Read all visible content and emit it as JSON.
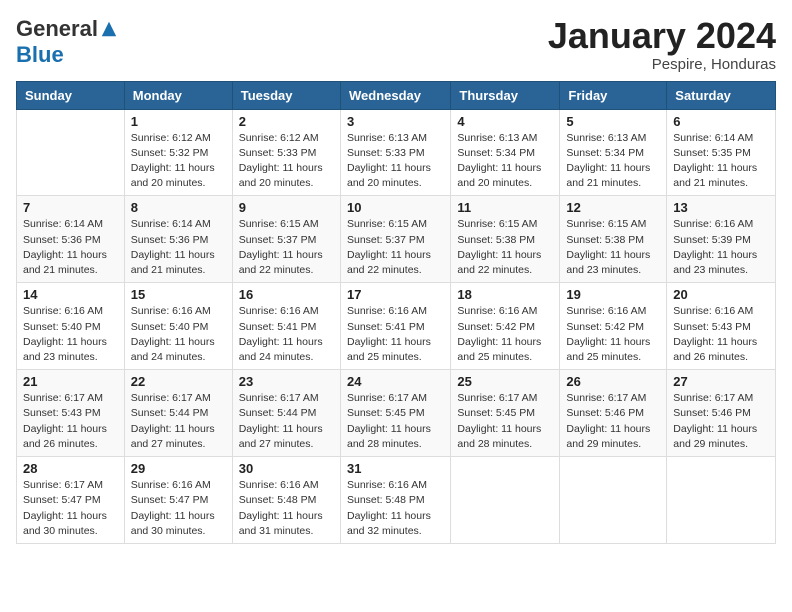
{
  "logo": {
    "general": "General",
    "blue": "Blue"
  },
  "header": {
    "month": "January 2024",
    "location": "Pespire, Honduras"
  },
  "weekdays": [
    "Sunday",
    "Monday",
    "Tuesday",
    "Wednesday",
    "Thursday",
    "Friday",
    "Saturday"
  ],
  "weeks": [
    [
      {
        "day": "",
        "info": ""
      },
      {
        "day": "1",
        "info": "Sunrise: 6:12 AM\nSunset: 5:32 PM\nDaylight: 11 hours\nand 20 minutes."
      },
      {
        "day": "2",
        "info": "Sunrise: 6:12 AM\nSunset: 5:33 PM\nDaylight: 11 hours\nand 20 minutes."
      },
      {
        "day": "3",
        "info": "Sunrise: 6:13 AM\nSunset: 5:33 PM\nDaylight: 11 hours\nand 20 minutes."
      },
      {
        "day": "4",
        "info": "Sunrise: 6:13 AM\nSunset: 5:34 PM\nDaylight: 11 hours\nand 20 minutes."
      },
      {
        "day": "5",
        "info": "Sunrise: 6:13 AM\nSunset: 5:34 PM\nDaylight: 11 hours\nand 21 minutes."
      },
      {
        "day": "6",
        "info": "Sunrise: 6:14 AM\nSunset: 5:35 PM\nDaylight: 11 hours\nand 21 minutes."
      }
    ],
    [
      {
        "day": "7",
        "info": "Sunrise: 6:14 AM\nSunset: 5:36 PM\nDaylight: 11 hours\nand 21 minutes."
      },
      {
        "day": "8",
        "info": "Sunrise: 6:14 AM\nSunset: 5:36 PM\nDaylight: 11 hours\nand 21 minutes."
      },
      {
        "day": "9",
        "info": "Sunrise: 6:15 AM\nSunset: 5:37 PM\nDaylight: 11 hours\nand 22 minutes."
      },
      {
        "day": "10",
        "info": "Sunrise: 6:15 AM\nSunset: 5:37 PM\nDaylight: 11 hours\nand 22 minutes."
      },
      {
        "day": "11",
        "info": "Sunrise: 6:15 AM\nSunset: 5:38 PM\nDaylight: 11 hours\nand 22 minutes."
      },
      {
        "day": "12",
        "info": "Sunrise: 6:15 AM\nSunset: 5:38 PM\nDaylight: 11 hours\nand 23 minutes."
      },
      {
        "day": "13",
        "info": "Sunrise: 6:16 AM\nSunset: 5:39 PM\nDaylight: 11 hours\nand 23 minutes."
      }
    ],
    [
      {
        "day": "14",
        "info": "Sunrise: 6:16 AM\nSunset: 5:40 PM\nDaylight: 11 hours\nand 23 minutes."
      },
      {
        "day": "15",
        "info": "Sunrise: 6:16 AM\nSunset: 5:40 PM\nDaylight: 11 hours\nand 24 minutes."
      },
      {
        "day": "16",
        "info": "Sunrise: 6:16 AM\nSunset: 5:41 PM\nDaylight: 11 hours\nand 24 minutes."
      },
      {
        "day": "17",
        "info": "Sunrise: 6:16 AM\nSunset: 5:41 PM\nDaylight: 11 hours\nand 25 minutes."
      },
      {
        "day": "18",
        "info": "Sunrise: 6:16 AM\nSunset: 5:42 PM\nDaylight: 11 hours\nand 25 minutes."
      },
      {
        "day": "19",
        "info": "Sunrise: 6:16 AM\nSunset: 5:42 PM\nDaylight: 11 hours\nand 25 minutes."
      },
      {
        "day": "20",
        "info": "Sunrise: 6:16 AM\nSunset: 5:43 PM\nDaylight: 11 hours\nand 26 minutes."
      }
    ],
    [
      {
        "day": "21",
        "info": "Sunrise: 6:17 AM\nSunset: 5:43 PM\nDaylight: 11 hours\nand 26 minutes."
      },
      {
        "day": "22",
        "info": "Sunrise: 6:17 AM\nSunset: 5:44 PM\nDaylight: 11 hours\nand 27 minutes."
      },
      {
        "day": "23",
        "info": "Sunrise: 6:17 AM\nSunset: 5:44 PM\nDaylight: 11 hours\nand 27 minutes."
      },
      {
        "day": "24",
        "info": "Sunrise: 6:17 AM\nSunset: 5:45 PM\nDaylight: 11 hours\nand 28 minutes."
      },
      {
        "day": "25",
        "info": "Sunrise: 6:17 AM\nSunset: 5:45 PM\nDaylight: 11 hours\nand 28 minutes."
      },
      {
        "day": "26",
        "info": "Sunrise: 6:17 AM\nSunset: 5:46 PM\nDaylight: 11 hours\nand 29 minutes."
      },
      {
        "day": "27",
        "info": "Sunrise: 6:17 AM\nSunset: 5:46 PM\nDaylight: 11 hours\nand 29 minutes."
      }
    ],
    [
      {
        "day": "28",
        "info": "Sunrise: 6:17 AM\nSunset: 5:47 PM\nDaylight: 11 hours\nand 30 minutes."
      },
      {
        "day": "29",
        "info": "Sunrise: 6:16 AM\nSunset: 5:47 PM\nDaylight: 11 hours\nand 30 minutes."
      },
      {
        "day": "30",
        "info": "Sunrise: 6:16 AM\nSunset: 5:48 PM\nDaylight: 11 hours\nand 31 minutes."
      },
      {
        "day": "31",
        "info": "Sunrise: 6:16 AM\nSunset: 5:48 PM\nDaylight: 11 hours\nand 32 minutes."
      },
      {
        "day": "",
        "info": ""
      },
      {
        "day": "",
        "info": ""
      },
      {
        "day": "",
        "info": ""
      }
    ]
  ]
}
